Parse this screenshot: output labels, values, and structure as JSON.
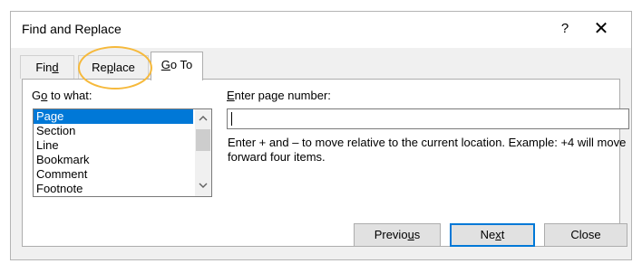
{
  "dialog": {
    "title": "Find and Replace",
    "help_label": "?",
    "close_label": "✕"
  },
  "tabs": [
    {
      "pre": "Fin",
      "ul": "d",
      "post": "",
      "active": false
    },
    {
      "pre": "Re",
      "ul": "p",
      "post": "lace",
      "active": false
    },
    {
      "pre": "",
      "ul": "G",
      "post": "o To",
      "active": true
    }
  ],
  "goto": {
    "label_pre": "G",
    "label_ul": "o",
    "label_post": " to what:",
    "items": [
      "Page",
      "Section",
      "Line",
      "Bookmark",
      "Comment",
      "Footnote"
    ],
    "selected": "Page"
  },
  "page_number": {
    "label_ul": "E",
    "label_post": "nter page number:",
    "value": ""
  },
  "hint": "Enter + and – to move relative to the current location. Example: +4 will move forward four items.",
  "buttons": {
    "previous": {
      "pre": "Previo",
      "ul": "u",
      "post": "s"
    },
    "next": {
      "pre": "Ne",
      "ul": "x",
      "post": "t"
    },
    "close": {
      "pre": "Close",
      "ul": "",
      "post": ""
    }
  },
  "colors": {
    "selection": "#0078d7",
    "highlight_ring": "#f6b93b",
    "dialog_bg": "#f0f0f0"
  }
}
